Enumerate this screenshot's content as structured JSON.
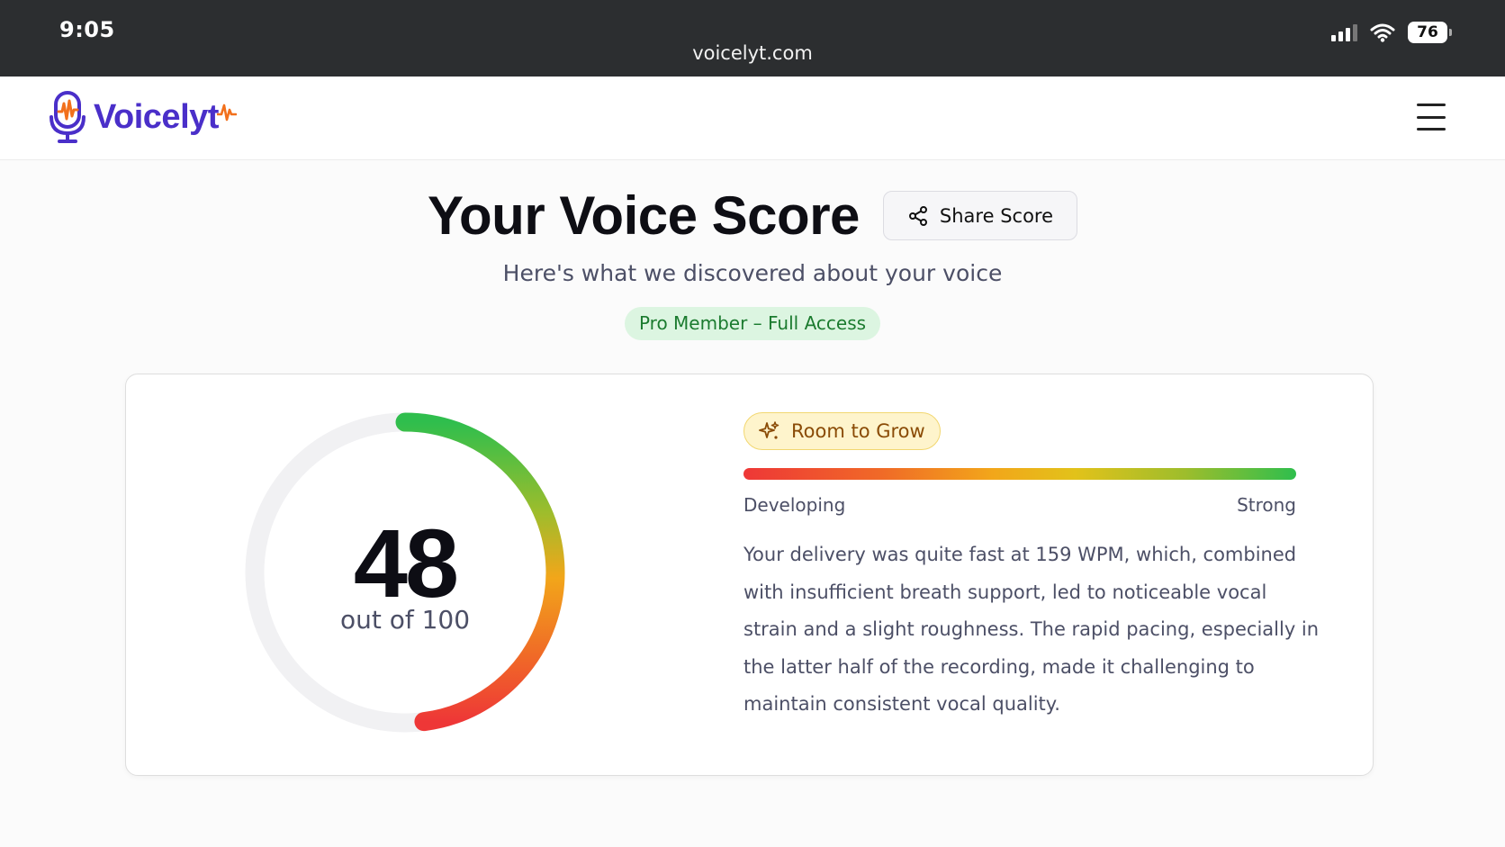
{
  "status_bar": {
    "time": "9:05",
    "url": "voicelyt.com",
    "battery": "76"
  },
  "header": {
    "logo_text": "Voicelyt",
    "menu_icon": "hamburger-menu-icon"
  },
  "page": {
    "title": "Your Voice Score",
    "share_label": "Share Score",
    "subtitle": "Here's what we discovered about your voice",
    "membership_badge": "Pro Member – Full Access"
  },
  "score": {
    "value": "48",
    "out_of": "out of 100",
    "fraction": 0.48,
    "level_label": "Room to Grow",
    "range_low": "Developing",
    "range_high": "Strong",
    "description": "Your delivery was quite fast at 159 WPM, which, combined with insufficient breath support, led to noticeable vocal strain and a slight roughness. The rapid pacing, especially in the latter half of the recording, made it challenging to maintain consistent vocal quality."
  },
  "colors": {
    "brand": "#4a2fc9",
    "accent_orange": "#f2701c",
    "gauge_red": "#ee3737",
    "gauge_yellow": "#f2a61a",
    "gauge_green": "#2fbe4d",
    "badge_green_bg": "#dcf5e1",
    "badge_yellow_bg": "#fef4cc"
  }
}
